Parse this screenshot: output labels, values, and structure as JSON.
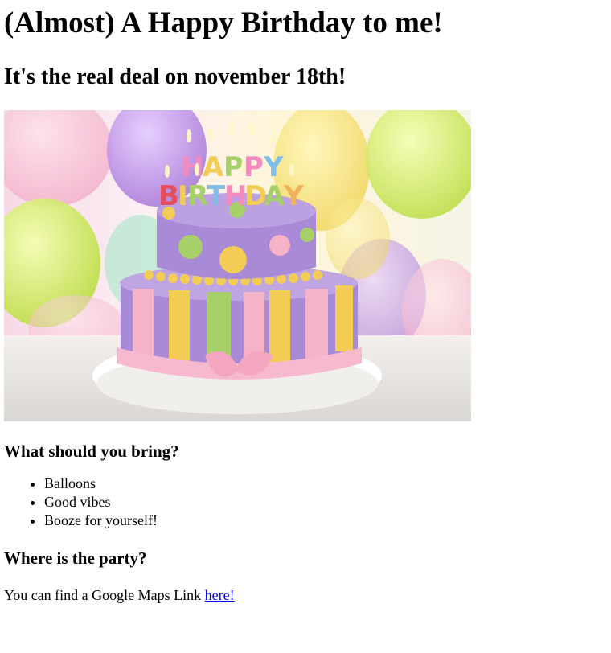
{
  "page": {
    "title": "(Almost) A Happy Birthday to me!",
    "subtitle": "It's the real deal on november 18th!"
  },
  "image": {
    "icon": "birthday-cake-photo",
    "candles": [
      "H",
      "A",
      "P",
      "P",
      "Y",
      "B",
      "I",
      "R",
      "T",
      "H",
      "D",
      "A",
      "Y"
    ],
    "colors": {
      "balloon_purple": "#b388e0",
      "balloon_green": "#c8e85a",
      "balloon_yellow": "#f4e06a",
      "balloon_pink": "#f7b6cf",
      "cake_purple": "#a98ad6",
      "cake_pink": "#f5b3c8",
      "cake_yellow": "#f2cc55",
      "cake_green": "#a7cf6a"
    }
  },
  "bring": {
    "heading": "What should you bring?",
    "items": [
      "Balloons",
      "Good vibes",
      "Booze for yourself!"
    ]
  },
  "party": {
    "heading": "Where is the party?",
    "text": "You can find a Google Maps Link ",
    "link_label": "here!"
  }
}
